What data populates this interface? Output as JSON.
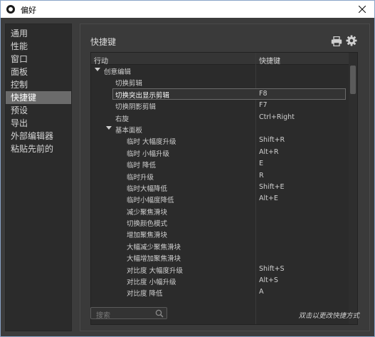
{
  "window": {
    "title": "偏好"
  },
  "sidebar": {
    "items": [
      {
        "label": "通用"
      },
      {
        "label": "性能"
      },
      {
        "label": "窗口"
      },
      {
        "label": "面板"
      },
      {
        "label": "控制"
      },
      {
        "label": "快捷键",
        "selected": true
      },
      {
        "label": "预设"
      },
      {
        "label": "导出"
      },
      {
        "label": "外部编辑器"
      },
      {
        "label": "粘贴先前的"
      }
    ]
  },
  "panel": {
    "title": "快捷键",
    "columns": {
      "action": "行动",
      "shortcut": "快捷键"
    },
    "rows": [
      {
        "label": "创意编辑",
        "key": "",
        "level": 0,
        "expandable": true
      },
      {
        "label": "切换剪辑",
        "key": "",
        "level": 1
      },
      {
        "label": "切换突出显示剪辑",
        "key": "F8",
        "level": 1,
        "selected": true
      },
      {
        "label": "切换阴影剪辑",
        "key": "F7",
        "level": 1
      },
      {
        "label": "右旋",
        "key": "Ctrl+Right",
        "level": 1
      },
      {
        "label": "基本面板",
        "key": "",
        "level": 1,
        "expandable": true
      },
      {
        "label": "临时 大幅度升级",
        "key": "Shift+R",
        "level": 2
      },
      {
        "label": "临时 小幅升级",
        "key": "Alt+R",
        "level": 2
      },
      {
        "label": "临时 降低",
        "key": "E",
        "level": 2
      },
      {
        "label": "临时升级",
        "key": "R",
        "level": 2
      },
      {
        "label": "临时大幅降低",
        "key": "Shift+E",
        "level": 2
      },
      {
        "label": "临时小幅度降低",
        "key": "Alt+E",
        "level": 2
      },
      {
        "label": "减少聚焦滑块",
        "key": "",
        "level": 2
      },
      {
        "label": "切换颜色模式",
        "key": "",
        "level": 2
      },
      {
        "label": "增加聚焦滑块",
        "key": "",
        "level": 2
      },
      {
        "label": "大幅减少聚焦滑块",
        "key": "",
        "level": 2
      },
      {
        "label": "大幅增加聚焦滑块",
        "key": "",
        "level": 2
      },
      {
        "label": "对比度 大幅度升级",
        "key": "Shift+S",
        "level": 2
      },
      {
        "label": "对比度 小幅升级",
        "key": "Alt+S",
        "level": 2
      },
      {
        "label": "对比度 降低",
        "key": "A",
        "level": 2
      }
    ],
    "search_placeholder": "搜索",
    "hint": "双击以更改快捷方式"
  }
}
